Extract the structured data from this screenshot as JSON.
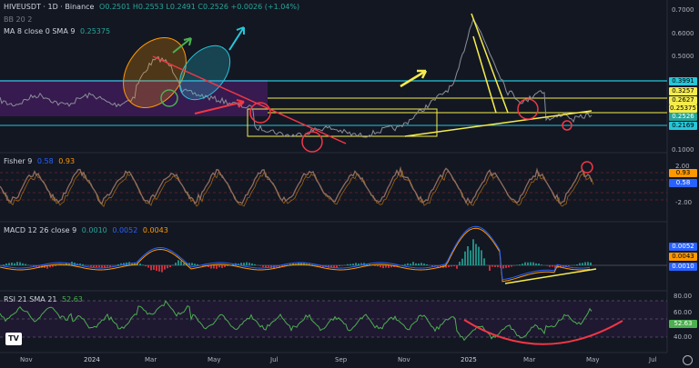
{
  "header": {
    "symbol": "HIVEUSDT · 1D · Binance",
    "ohlc": "O0.2501  H0.2553  L0.2491  C0.2526  +0.0026 (+1.04%)",
    "bb": "BB 20 2",
    "ma": "MA 8 close 0 SMA 9",
    "ma_value": "0.25375"
  },
  "price_axis": {
    "ticks": [
      "0.7000",
      "0.6000",
      "0.5000",
      "0.1000",
      "0.0000"
    ],
    "tags": [
      {
        "text": "0.3991",
        "bg": "#26c6da",
        "fg": "#000000"
      },
      {
        "text": "0.3257",
        "bg": "#f5ec4c",
        "fg": "#000000"
      },
      {
        "text": "0.2627",
        "bg": "#f5ec4c",
        "fg": "#000000"
      },
      {
        "text": "0.25375",
        "bg": "#f5ec4c",
        "fg": "#000000"
      },
      {
        "text": "0.2526",
        "bg": "#26a69a",
        "fg": "#ffffff"
      },
      {
        "text": "0.2169",
        "bg": "#26c6da",
        "fg": "#000000"
      }
    ]
  },
  "fisher": {
    "label": "Fisher 9",
    "v1": "0.58",
    "v2": "0.93",
    "ticks": [
      "2.00",
      "0.00",
      "-2.00"
    ],
    "tags": [
      {
        "text": "0.93",
        "bg": "#ff9800",
        "fg": "#000000"
      },
      {
        "text": "0.58",
        "bg": "#2962ff",
        "fg": "#ffffff"
      }
    ]
  },
  "macd": {
    "label": "MACD 12 26 close 9",
    "v1": "0.0010",
    "v2": "0.0052",
    "v3": "0.0043",
    "tags": [
      {
        "text": "0.0052",
        "bg": "#2962ff",
        "fg": "#ffffff"
      },
      {
        "text": "0.0043",
        "bg": "#ff9800",
        "fg": "#000000"
      },
      {
        "text": "0.0010",
        "bg": "#2962ff",
        "fg": "#ffffff"
      }
    ]
  },
  "rsi": {
    "label": "RSI 21 SMA 21",
    "value": "52.63",
    "ticks": [
      "80.00",
      "60.00",
      "40.00"
    ],
    "tag": {
      "text": "52.63",
      "bg": "#4caf50",
      "fg": "#ffffff"
    }
  },
  "time_axis": [
    "Nov",
    "2024",
    "Mar",
    "May",
    "Jul",
    "Sep",
    "Nov",
    "2025",
    "Mar",
    "May",
    "Jul"
  ],
  "logo": "TV",
  "icons": {
    "settings": "gear-icon"
  },
  "colors": {
    "background": "#131722",
    "price_line": "#8a8f9a",
    "fisher": "#8d6e63",
    "macd": "#2962ff",
    "signal": "#ff9800",
    "rsi": "#4caf50",
    "annotation_red": "#f23645",
    "annotation_yellow": "#f5ec4c",
    "annotation_cyan": "#26c6da",
    "annotation_green": "#4caf50",
    "bb_fill": "#7b1fa2"
  }
}
